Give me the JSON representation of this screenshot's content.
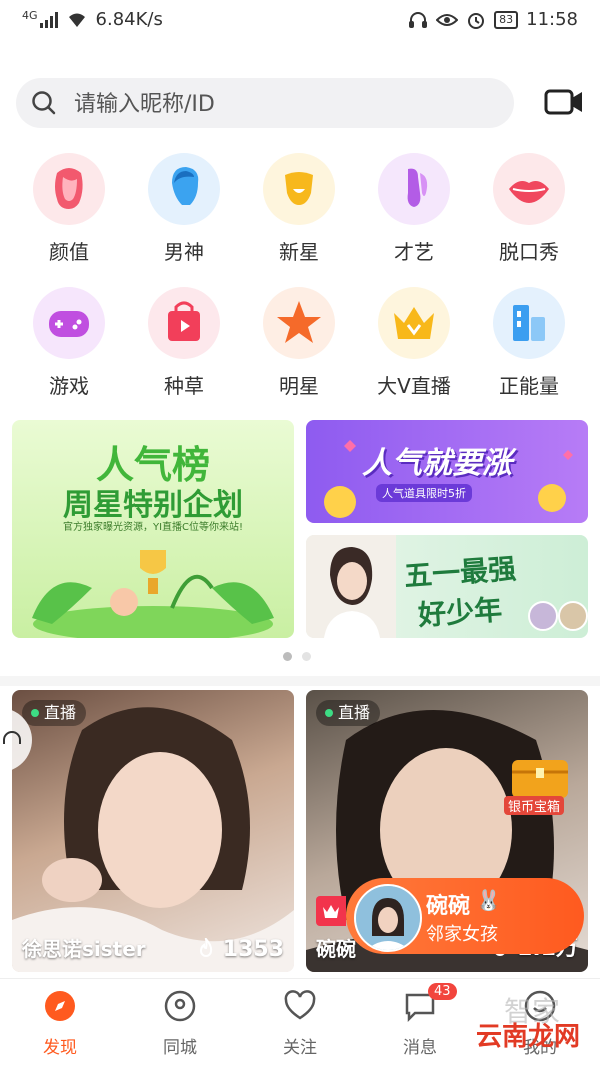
{
  "status": {
    "network": "4G",
    "speed": "6.84K/s",
    "battery": "83",
    "time": "11:58"
  },
  "search": {
    "placeholder": "请输入昵称/ID"
  },
  "categories": [
    {
      "label": "颜值",
      "icon": "face-icon",
      "color": "#f2596e"
    },
    {
      "label": "男神",
      "icon": "male-head-icon",
      "color": "#3ba3f0"
    },
    {
      "label": "新星",
      "icon": "smile-star-icon",
      "color": "#f7b81c"
    },
    {
      "label": "才艺",
      "icon": "ballet-icon",
      "color": "#b35ce6"
    },
    {
      "label": "脱口秀",
      "icon": "lips-icon",
      "color": "#f0475e"
    },
    {
      "label": "游戏",
      "icon": "gamepad-icon",
      "color": "#c04fe0"
    },
    {
      "label": "种草",
      "icon": "shopping-bag-icon",
      "color": "#f23f5a"
    },
    {
      "label": "明星",
      "icon": "star-icon",
      "color": "#f56a2a"
    },
    {
      "label": "大V直播",
      "icon": "crown-icon",
      "color": "#f8b81a"
    },
    {
      "label": "正能量",
      "icon": "building-icon",
      "color": "#3b9ef0"
    }
  ],
  "banners": {
    "main": {
      "title": "人气榜",
      "subtitle": "周星特别企划",
      "caption": "官方独家曝光资源，YI直播C位等你来站!"
    },
    "top_right": {
      "title": "人气就要涨",
      "caption": "人气道具限时5折"
    },
    "bottom_right": {
      "title": "五一最强",
      "subtitle": "好少年"
    }
  },
  "cards": [
    {
      "tag": "直播",
      "name": "徐思诺sister",
      "hot": "1353"
    },
    {
      "tag": "直播",
      "name": "碗碗",
      "hot": "1.1万",
      "chest": "银币宝箱"
    }
  ],
  "popup": {
    "name": "碗碗",
    "desc": "邻家女孩"
  },
  "nav": [
    {
      "label": "发现",
      "active": true
    },
    {
      "label": "同城"
    },
    {
      "label": "关注"
    },
    {
      "label": "消息",
      "badge": "43"
    },
    {
      "label": "我的"
    }
  ],
  "watermark": {
    "text": "云南龙网",
    "faint": "智家"
  },
  "colors": {
    "accent": "#ff5a1f",
    "badge": "#f2453d"
  }
}
